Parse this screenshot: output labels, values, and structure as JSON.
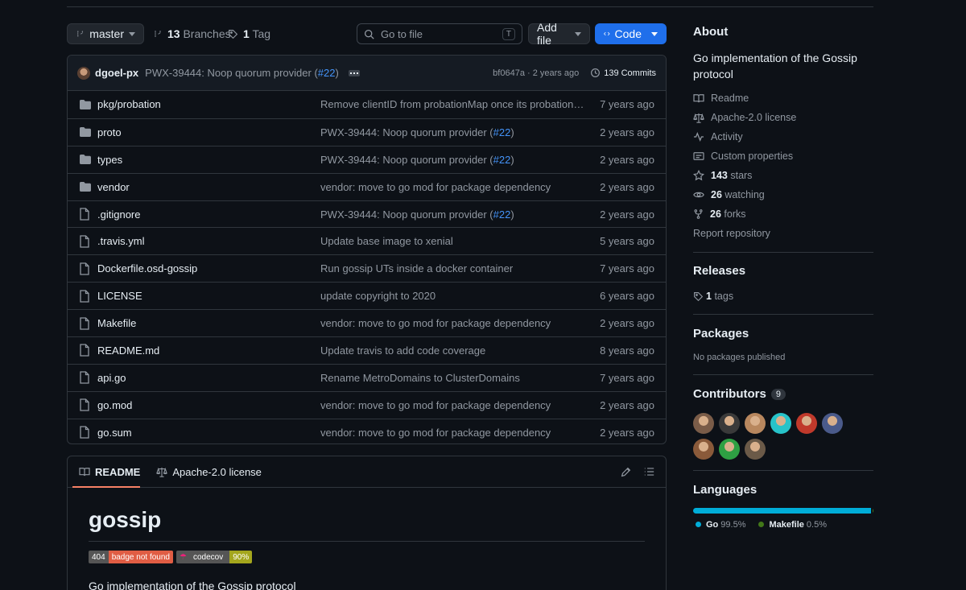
{
  "toolbar": {
    "branch": "master",
    "branches_count": "13",
    "branches_label": "Branches",
    "tags_count": "1",
    "tags_label": "Tag",
    "search_placeholder": "Go to file",
    "search_shortcut": "T",
    "add_file": "Add file",
    "code": "Code"
  },
  "commit": {
    "author": "dgoel-px",
    "message": "PWX-39444: Noop quorum provider (",
    "pr": "#22",
    "message_end": ")",
    "meta": "bf0647a · 2 years ago",
    "commits": "139 Commits"
  },
  "files": [
    {
      "type": "dir",
      "name": "pkg/probation",
      "msg": "Remove clientID from probationMap once its probation time ...",
      "pr": "",
      "age": "7 years ago"
    },
    {
      "type": "dir",
      "name": "proto",
      "msg": "PWX-39444: Noop quorum provider (",
      "pr": "#22",
      "age": "2 years ago"
    },
    {
      "type": "dir",
      "name": "types",
      "msg": "PWX-39444: Noop quorum provider (",
      "pr": "#22",
      "age": "2 years ago"
    },
    {
      "type": "dir",
      "name": "vendor",
      "msg": "vendor: move to go mod for package dependency",
      "pr": "",
      "age": "2 years ago"
    },
    {
      "type": "file",
      "name": ".gitignore",
      "msg": "PWX-39444: Noop quorum provider (",
      "pr": "#22",
      "age": "2 years ago"
    },
    {
      "type": "file",
      "name": ".travis.yml",
      "msg": "Update base image to xenial",
      "pr": "",
      "age": "5 years ago"
    },
    {
      "type": "file",
      "name": "Dockerfile.osd-gossip",
      "msg": "Run gossip UTs inside a docker container",
      "pr": "",
      "age": "7 years ago"
    },
    {
      "type": "file",
      "name": "LICENSE",
      "msg": "update copyright to 2020",
      "pr": "",
      "age": "6 years ago"
    },
    {
      "type": "file",
      "name": "Makefile",
      "msg": "vendor: move to go mod for package dependency",
      "pr": "",
      "age": "2 years ago"
    },
    {
      "type": "file",
      "name": "README.md",
      "msg": "Update travis to add code coverage",
      "pr": "",
      "age": "8 years ago"
    },
    {
      "type": "file",
      "name": "api.go",
      "msg": "Rename MetroDomains to ClusterDomains",
      "pr": "",
      "age": "7 years ago"
    },
    {
      "type": "file",
      "name": "go.mod",
      "msg": "vendor: move to go mod for package dependency",
      "pr": "",
      "age": "2 years ago"
    },
    {
      "type": "file",
      "name": "go.sum",
      "msg": "vendor: move to go mod for package dependency",
      "pr": "",
      "age": "2 years ago"
    }
  ],
  "readme": {
    "tab_readme": "README",
    "tab_license": "Apache-2.0 license",
    "title": "gossip",
    "badge1_left": "404",
    "badge1_right": "badge not found",
    "badge2_left": "codecov",
    "badge2_right": "90%",
    "description": "Go implementation of the Gossip protocol"
  },
  "about": {
    "title": "About",
    "description": "Go implementation of the Gossip protocol",
    "readme": "Readme",
    "license": "Apache-2.0 license",
    "activity": "Activity",
    "custom_properties": "Custom properties",
    "stars_count": "143",
    "stars_label": "stars",
    "watching_count": "26",
    "watching_label": "watching",
    "forks_count": "26",
    "forks_label": "forks",
    "report": "Report repository"
  },
  "releases": {
    "title": "Releases",
    "tags_count": "1",
    "tags_label": "tags"
  },
  "packages": {
    "title": "Packages",
    "none": "No packages published"
  },
  "contributors": {
    "title": "Contributors",
    "count": "9",
    "avatar_colors": [
      "#7a5c48",
      "#3a3a3a",
      "#b8875e",
      "#27c3c9",
      "#c0392b",
      "#4a5a8a",
      "#8a5a3a",
      "#2ea043",
      "#6b5a48"
    ]
  },
  "languages": {
    "title": "Languages",
    "items": [
      {
        "name": "Go",
        "percent": "99.5%",
        "value": 99.5,
        "color": "#00ADD8"
      },
      {
        "name": "Makefile",
        "percent": "0.5%",
        "value": 0.5,
        "color": "#427819"
      }
    ]
  }
}
